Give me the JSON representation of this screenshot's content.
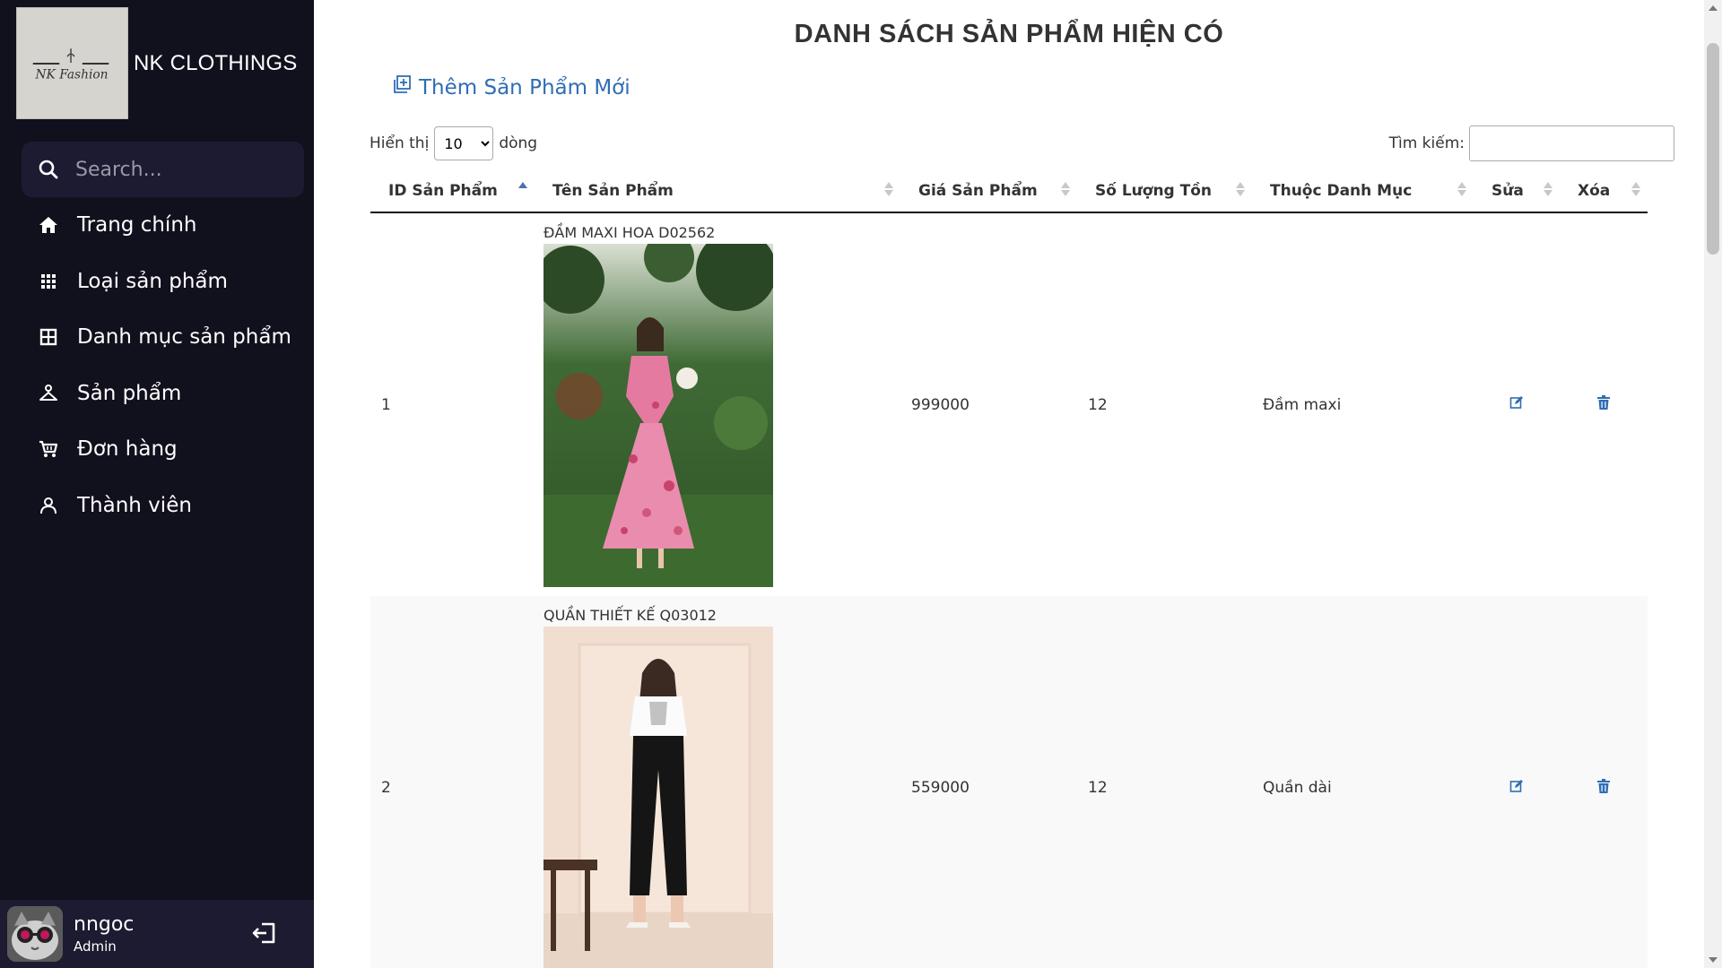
{
  "sidebar": {
    "brand": {
      "logo_text": "NK Fashion",
      "name": "NK CLOTHINGS"
    },
    "search": {
      "placeholder": "Search..."
    },
    "items": [
      {
        "label": "Trang chính",
        "icon": "home-icon"
      },
      {
        "label": "Loại sản phẩm",
        "icon": "grid-dots-icon"
      },
      {
        "label": "Danh mục sản phẩm",
        "icon": "table-grid-icon"
      },
      {
        "label": "Sản phẩm",
        "icon": "hanger-icon"
      },
      {
        "label": "Đơn hàng",
        "icon": "cart-icon"
      },
      {
        "label": "Thành viên",
        "icon": "user-icon"
      }
    ],
    "profile": {
      "name": "nngoc",
      "role": "Admin"
    }
  },
  "main": {
    "title": "DANH SÁCH SẢN PHẨM HIỆN CÓ",
    "add_new_label": "Thêm Sản Phẩm Mới",
    "length": {
      "prefix": "Hiển thị",
      "value": "10",
      "suffix": "dòng",
      "options": [
        "10"
      ]
    },
    "filter": {
      "label": "Tìm kiếm:",
      "value": ""
    },
    "table": {
      "headers": [
        "ID Sản Phẩm",
        "Tên Sản Phẩm",
        "Giá Sản Phẩm",
        "Số Lượng Tồn",
        "Thuộc Danh Mục",
        "Sửa",
        "Xóa"
      ],
      "rows": [
        {
          "id": "1",
          "name": "ĐẦM MAXI HOA D02562",
          "price": "999000",
          "stock": "12",
          "category": "Đầm maxi"
        },
        {
          "id": "2",
          "name": "QUẦN THIẾT KẾ Q03012",
          "price": "559000",
          "stock": "12",
          "category": "Quần dài"
        }
      ]
    }
  },
  "colors": {
    "sidebar_bg": "#11101d",
    "sidebar_panel": "#1d1b31",
    "accent_blue": "#2f6db5"
  }
}
